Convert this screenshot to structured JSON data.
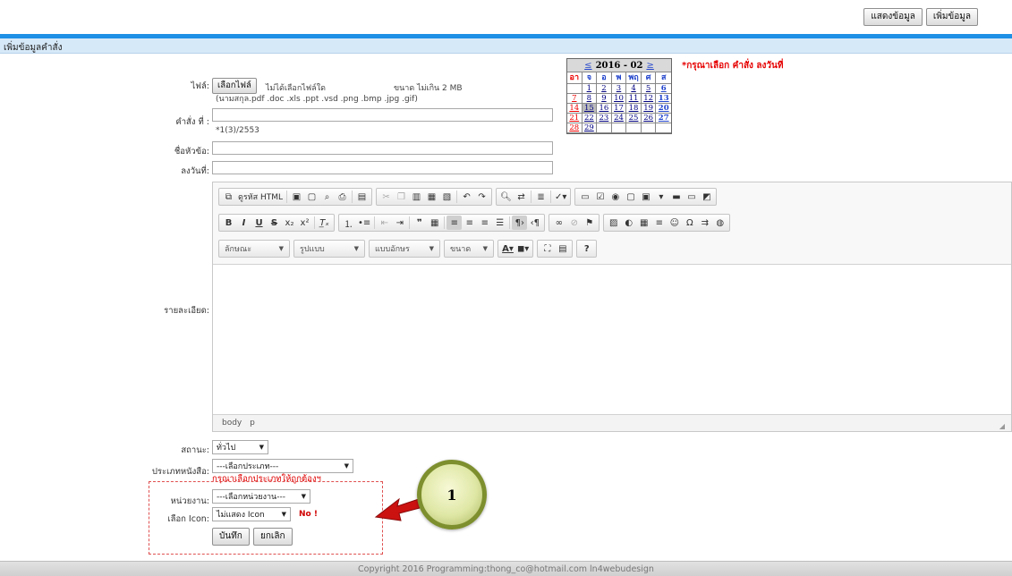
{
  "top_buttons": {
    "show": "แสดงข้อมูล",
    "add": "เพิ่มข้อมูล"
  },
  "section_title": "เพิ่มข้อมูลคำสั่ง",
  "file": {
    "label": "ไฟล์:",
    "choose_button": "เลือกไฟล์",
    "no_file_text": "ไม่ได้เลือกไฟล์ใด",
    "size_note": "ขนาด ไม่เกิน 2 MB",
    "ext_note": "(นามสกุล.pdf .doc .xls .ppt .vsd .png .bmp .jpg .gif)"
  },
  "order_no": {
    "label": "คำสั่ง ที่ :",
    "value": "",
    "hint": "*1(3)/2553"
  },
  "subject": {
    "label": "ชื่อหัวข้อ:",
    "value": ""
  },
  "sign_date": {
    "label": "ลงวันที่:",
    "value": ""
  },
  "required_note": "*กรุณาเลือก คำสั่ง ลงวันที่",
  "calendar": {
    "title": "2016 - 02",
    "prev": "≤",
    "next": "≥",
    "days_of_week": [
      "อา",
      "จ",
      "อ",
      "พ",
      "พฤ",
      "ศ",
      "ส"
    ],
    "weeks": [
      [
        "",
        "1",
        "2",
        "3",
        "4",
        "5",
        "6"
      ],
      [
        "7",
        "8",
        "9",
        "10",
        "11",
        "12",
        "13"
      ],
      [
        "14",
        "15",
        "16",
        "17",
        "18",
        "19",
        "20"
      ],
      [
        "21",
        "22",
        "23",
        "24",
        "25",
        "26",
        "27"
      ],
      [
        "28",
        "29",
        "",
        "",
        "",
        "",
        ""
      ]
    ],
    "today": "15"
  },
  "detail": {
    "label": "รายละเอียด:"
  },
  "editor": {
    "source_label": "ดูรหัส HTML",
    "combos": [
      "ลักษณะ",
      "รูปแบบ",
      "แบบอักษร",
      "ขนาด"
    ],
    "status_path": [
      "body",
      "p"
    ]
  },
  "status_field": {
    "label": "สถานะ:",
    "value": "ทั่วไป"
  },
  "doc_type": {
    "label": "ประเภทหนังสือ:",
    "value": "---เลือกประเภท---",
    "error": "กรุณาเลือกประเภทให้ถูกต้องฯ"
  },
  "department": {
    "label": "หน่วยงาน:",
    "value": "---เลือกหน่วยงาน---"
  },
  "icon_select": {
    "label": "เลือก Icon:",
    "value": "ไม่แสดง Icon",
    "note": "No !"
  },
  "actions": {
    "save": "บันทึก",
    "cancel": "ยกเลิก"
  },
  "annotation": {
    "number": "1",
    "color": "#cc1111"
  },
  "footer": "Copyright 2016 Programming:thong_co@hotmail.com ln4webudesign",
  "colors": {
    "top_bar": "#1e90e6",
    "section_bar": "#d6e9f8",
    "error": "#e00000"
  }
}
